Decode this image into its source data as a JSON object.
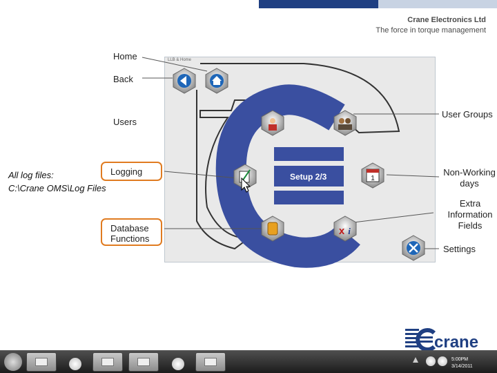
{
  "header": {
    "company": "Crane Electronics Ltd",
    "tagline": "The force in torque management"
  },
  "screen": {
    "title": "LLB & Home",
    "setup_label": "Setup 2/3"
  },
  "callouts": {
    "home": "Home",
    "back": "Back",
    "users": "Users",
    "logging": "Logging",
    "database_line1": "Database",
    "database_line2": "Functions",
    "user_groups": "User Groups",
    "non_working_line1": "Non-Working",
    "non_working_line2": "days",
    "extra_line1": "Extra",
    "extra_line2": "Information",
    "extra_line3": "Fields",
    "settings": "Settings"
  },
  "note": {
    "line1": "All log files:",
    "line2": "C:\\Crane OMS\\Log Files"
  },
  "logo": {
    "text": "crane"
  },
  "taskbar": {
    "time": "5:00PM",
    "date": "3/14/2011"
  },
  "icons": [
    "home-icon",
    "back-icon",
    "user-icon",
    "user-groups-icon",
    "logging-icon",
    "calendar-icon",
    "database-icon",
    "extra-info-icon",
    "settings-icon"
  ],
  "colors": {
    "accent": "#e07b20",
    "blue": "#3a4fa0",
    "dark_blue": "#1f3f82"
  }
}
